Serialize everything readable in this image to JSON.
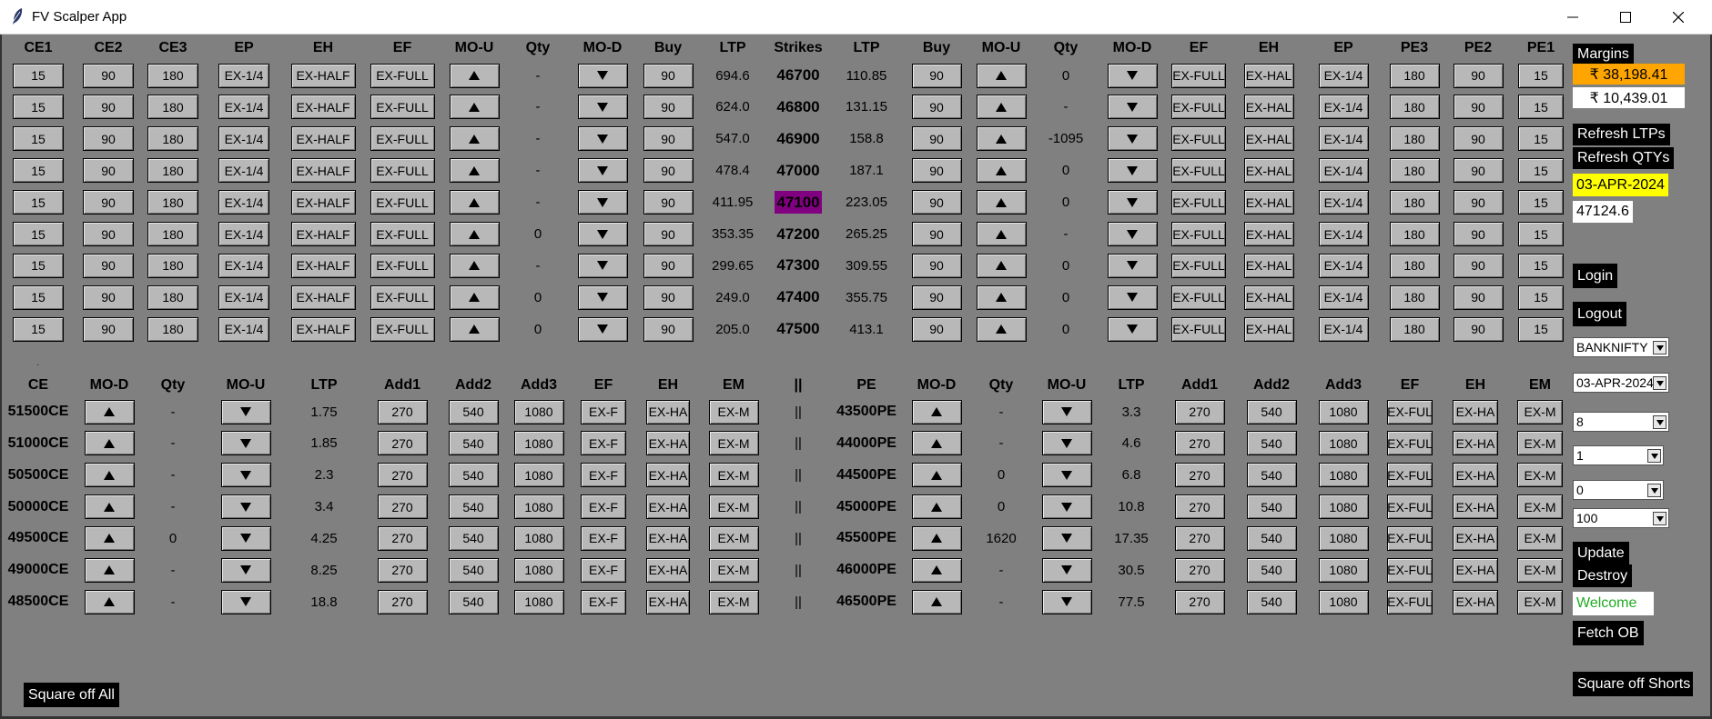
{
  "window": {
    "title": "FV Scalper App"
  },
  "top": {
    "headers": [
      "CE1",
      "CE2",
      "CE3",
      "EP",
      "EH",
      "EF",
      "MO-U",
      "Qty",
      "MO-D",
      "Buy",
      "LTP",
      "Strikes",
      "LTP",
      "Buy",
      "MO-U",
      "Qty",
      "MO-D",
      "EF",
      "EH",
      "EP",
      "PE3",
      "PE2",
      "PE1"
    ],
    "ce_btn": [
      "15",
      "90",
      "180",
      "EX-1/4",
      "EX-HALF",
      "EX-FULL"
    ],
    "buy_label": "90",
    "pe_btn": [
      "EX-FULL",
      "EX-HAL",
      "EX-1/4",
      "180",
      "90",
      "15"
    ],
    "rows": [
      {
        "ce_qty": "-",
        "ce_ltp": "694.6",
        "strike": "46700",
        "pe_ltp": "110.85",
        "pe_qty": "0"
      },
      {
        "ce_qty": "-",
        "ce_ltp": "624.0",
        "strike": "46800",
        "pe_ltp": "131.15",
        "pe_qty": "-"
      },
      {
        "ce_qty": "-",
        "ce_ltp": "547.0",
        "strike": "46900",
        "pe_ltp": "158.8",
        "pe_qty": "-1095"
      },
      {
        "ce_qty": "-",
        "ce_ltp": "478.4",
        "strike": "47000",
        "pe_ltp": "187.1",
        "pe_qty": "0"
      },
      {
        "ce_qty": "-",
        "ce_ltp": "411.95",
        "strike": "47100",
        "pe_ltp": "223.05",
        "pe_qty": "0"
      },
      {
        "ce_qty": "0",
        "ce_ltp": "353.35",
        "strike": "47200",
        "pe_ltp": "265.25",
        "pe_qty": "-"
      },
      {
        "ce_qty": "-",
        "ce_ltp": "299.65",
        "strike": "47300",
        "pe_ltp": "309.55",
        "pe_qty": "0"
      },
      {
        "ce_qty": "0",
        "ce_ltp": "249.0",
        "strike": "47400",
        "pe_ltp": "355.75",
        "pe_qty": "0"
      },
      {
        "ce_qty": "0",
        "ce_ltp": "205.0",
        "strike": "47500",
        "pe_ltp": "413.1",
        "pe_qty": "0"
      }
    ],
    "highlight_color": "#800080"
  },
  "bottom": {
    "headers": [
      "CE",
      "MO-D",
      "Qty",
      "MO-U",
      "LTP",
      "Add1",
      "Add2",
      "Add3",
      "EF",
      "EH",
      "EM",
      "||",
      "PE",
      "MO-D",
      "Qty",
      "MO-U",
      "LTP",
      "Add1",
      "Add2",
      "Add3",
      "EF",
      "EH",
      "EM"
    ],
    "ce_btn": [
      "270",
      "540",
      "1080",
      "EX-F",
      "EX-HA",
      "EX-M"
    ],
    "pe_btn": [
      "270",
      "540",
      "1080",
      "EX-FUL",
      "EX-HA",
      "EX-M"
    ],
    "sep": "||",
    "rows": [
      {
        "ce": "51500CE",
        "ce_qty": "-",
        "ce_ltp": "1.75",
        "pe": "43500PE",
        "pe_qty": "-",
        "pe_ltp": "3.3"
      },
      {
        "ce": "51000CE",
        "ce_qty": "-",
        "ce_ltp": "1.85",
        "pe": "44000PE",
        "pe_qty": "-",
        "pe_ltp": "4.6"
      },
      {
        "ce": "50500CE",
        "ce_qty": "-",
        "ce_ltp": "2.3",
        "pe": "44500PE",
        "pe_qty": "0",
        "pe_ltp": "6.8"
      },
      {
        "ce": "50000CE",
        "ce_qty": "-",
        "ce_ltp": "3.4",
        "pe": "45000PE",
        "pe_qty": "0",
        "pe_ltp": "10.8"
      },
      {
        "ce": "49500CE",
        "ce_qty": "0",
        "ce_ltp": "4.25",
        "pe": "45500PE",
        "pe_qty": "1620",
        "pe_ltp": "17.35"
      },
      {
        "ce": "49000CE",
        "ce_qty": "-",
        "ce_ltp": "8.25",
        "pe": "46000PE",
        "pe_qty": "-",
        "pe_ltp": "30.5"
      },
      {
        "ce": "48500CE",
        "ce_qty": "-",
        "ce_ltp": "18.8",
        "pe": "46500PE",
        "pe_qty": "-",
        "pe_ltp": "77.5"
      }
    ]
  },
  "side": {
    "margins_label": "Margins",
    "margin1": "₹ 38,198.41",
    "margin1_color": "#ffa500",
    "margin2": "₹ 10,439.01",
    "refresh_ltps": "Refresh LTPs",
    "refresh_qtys": "Refresh QTYs",
    "date": "03-APR-2024",
    "date_color": "#ffff00",
    "spot": "47124.6",
    "login": "Login",
    "logout": "Logout",
    "symbol_select": "BANKNIFTY",
    "expiry_select": "03-APR-2024",
    "combo_a": "8",
    "combo_b": "1",
    "combo_c": "0",
    "combo_d": "100",
    "update": "Update",
    "destroy": "Destroy",
    "welcome": "Welcome",
    "welcome_color": "#22aa22",
    "fetch_ob": "Fetch OB",
    "square_off_shorts": "Square off Shorts"
  },
  "footer": {
    "square_off_all": "Square off All"
  }
}
